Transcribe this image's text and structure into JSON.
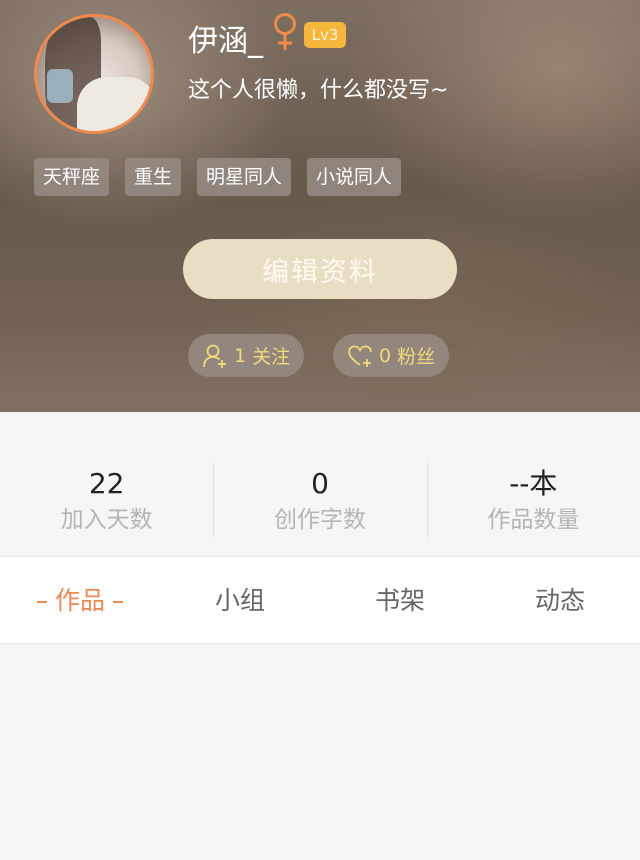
{
  "profile": {
    "username": "伊涵_",
    "level": "Lv3",
    "bio": "这个人很懒，什么都没写~",
    "tags": [
      "天秤座",
      "重生",
      "明星同人",
      "小说同人"
    ]
  },
  "actions": {
    "edit_label": "编辑资料"
  },
  "social": {
    "following_count": "1",
    "following_label": "关注",
    "followers_count": "0",
    "followers_label": "粉丝"
  },
  "stats": [
    {
      "value": "22",
      "label": "加入天数"
    },
    {
      "value": "0",
      "label": "创作字数"
    },
    {
      "value": "--本",
      "label": "作品数量"
    }
  ],
  "tabs": [
    {
      "label": "作品"
    },
    {
      "label": "小组"
    },
    {
      "label": "书架"
    },
    {
      "label": "动态"
    }
  ],
  "colors": {
    "accent": "#ee8654",
    "avatar_border": "#f08a4b",
    "level_badge": "#f4b73b",
    "social_text": "#f4d97a",
    "edit_button": "#e8dec4"
  },
  "icons": {
    "gender": "female-icon",
    "following": "add-user-icon",
    "followers": "heart-plus-icon"
  }
}
